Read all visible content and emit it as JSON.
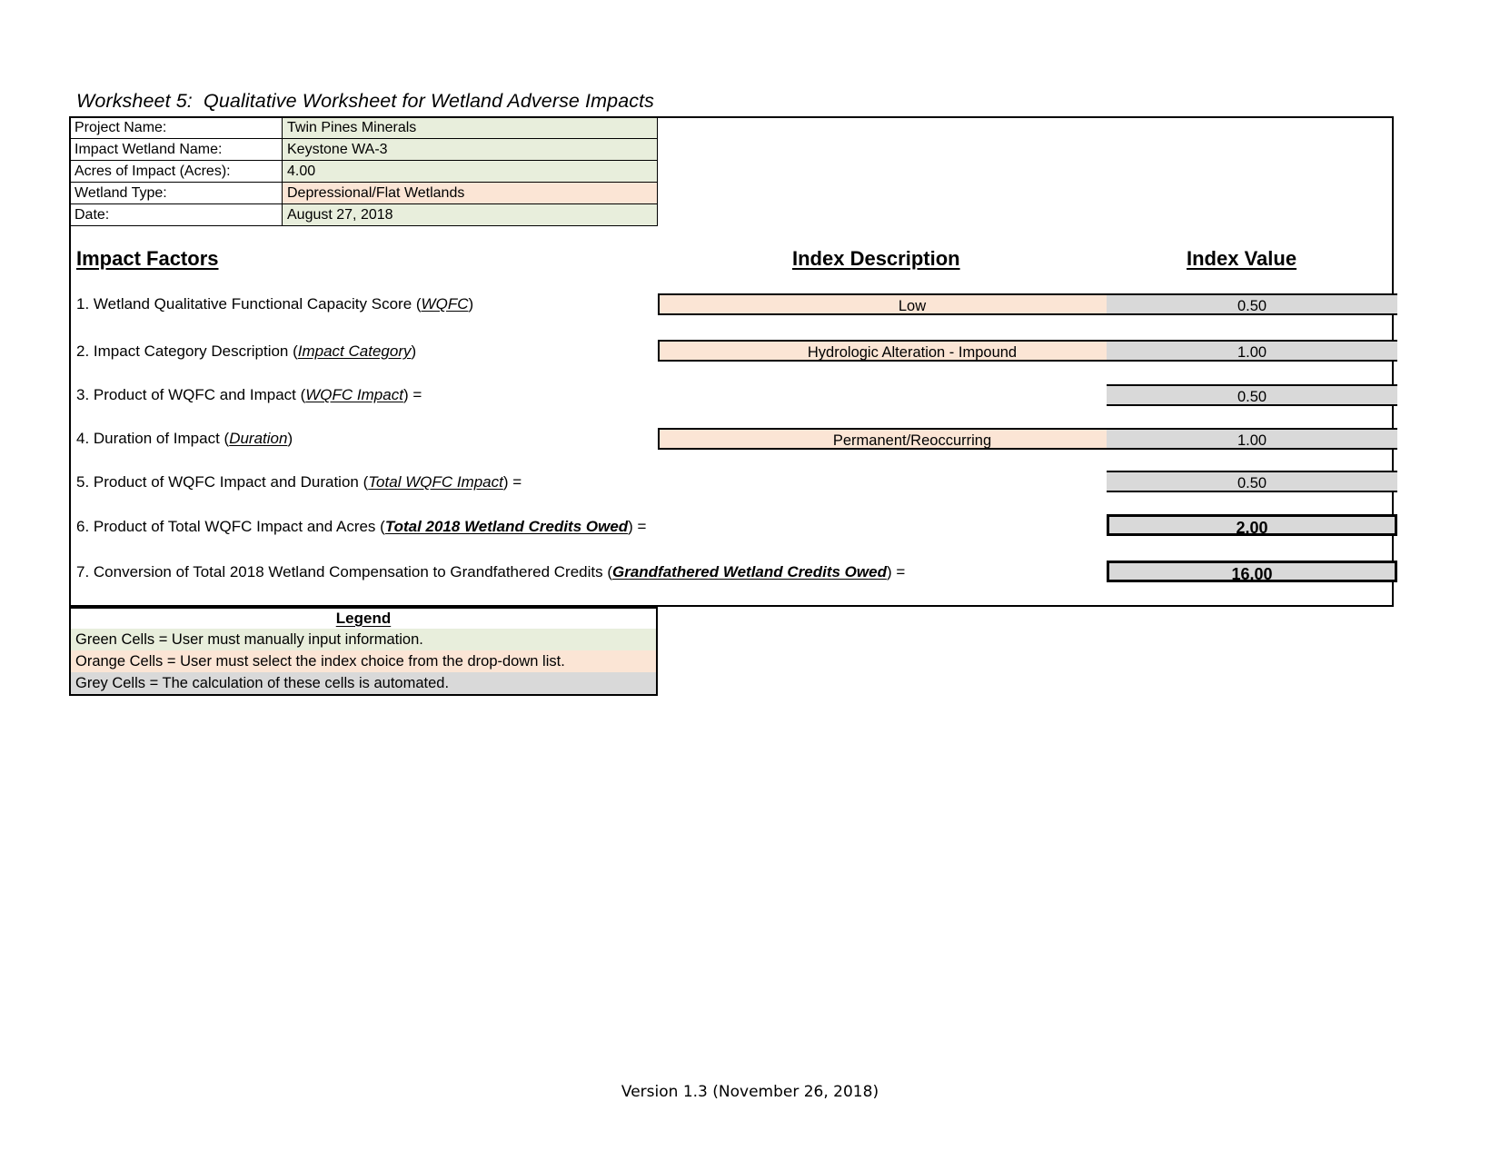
{
  "title": "Worksheet 5:  Qualitative Worksheet for Wetland Adverse Impacts",
  "info": {
    "rows": [
      {
        "label": "Project Name:",
        "value": "Twin Pines Minerals",
        "fill": "green"
      },
      {
        "label": "Impact Wetland Name:",
        "value": "Keystone WA-3",
        "fill": "green"
      },
      {
        "label": "Acres of Impact (Acres):",
        "value": "4.00",
        "fill": "green"
      },
      {
        "label": "Wetland Type:",
        "value": "Depressional/Flat Wetlands",
        "fill": "orange"
      },
      {
        "label": "Date:",
        "value": "August 27, 2018",
        "fill": "green"
      }
    ]
  },
  "headers": {
    "impact_factors": "Impact Factors",
    "index_description": "Index Description",
    "index_value": "Index Value"
  },
  "factors": [
    {
      "number": "1.",
      "text_before": "1. Wetland Qualitative Functional Capacity Score (",
      "term": "WQFC",
      "text_after": ")",
      "description": "Low",
      "value": "0.50",
      "emphasis": false
    },
    {
      "number": "2.",
      "text_before": "2. Impact Category Description (",
      "term": "Impact Category",
      "text_after": ")",
      "description": "Hydrologic Alteration - Impound",
      "value": "1.00",
      "emphasis": false
    },
    {
      "number": "3.",
      "text_before": "3. Product of WQFC and Impact (",
      "term": "WQFC Impact",
      "text_after": ") =",
      "description": "",
      "value": "0.50",
      "emphasis": false
    },
    {
      "number": "4.",
      "text_before": "4. Duration of Impact (",
      "term": "Duration",
      "text_after": ")",
      "description": "Permanent/Reoccurring",
      "value": "1.00",
      "emphasis": false
    },
    {
      "number": "5.",
      "text_before": "5. Product of WQFC Impact and Duration (",
      "term": "Total WQFC Impact",
      "text_after": ") =",
      "description": "",
      "value": "0.50",
      "emphasis": false
    },
    {
      "number": "6.",
      "text_before": "6. Product of Total WQFC Impact and Acres (",
      "term": "Total 2018 Wetland Credits Owed",
      "text_after": ") =",
      "description": "",
      "value": "2.00",
      "emphasis": true
    },
    {
      "number": "7.",
      "text_before": "7. Conversion of Total 2018 Wetland Compensation to Grandfathered Credits (",
      "term": "Grandfathered Wetland Credits Owed",
      "text_after": ") =",
      "description": "",
      "value": "16.00",
      "emphasis": true
    }
  ],
  "legend": {
    "title": "Legend",
    "rows": [
      {
        "text": "Green Cells = User must manually input information.",
        "fill": "green"
      },
      {
        "text": "Orange Cells = User must select the index choice from the drop-down list.",
        "fill": "orange"
      },
      {
        "text": "Grey Cells = The calculation of these cells is automated.",
        "fill": "grey"
      }
    ]
  },
  "footer": {
    "version": "Version 1.3 (November 26, 2018)"
  },
  "colors": {
    "green_fill": "#e8eedc",
    "orange_fill": "#fbe5d5",
    "grey_fill": "#d9d9d9",
    "border": "#000000"
  }
}
